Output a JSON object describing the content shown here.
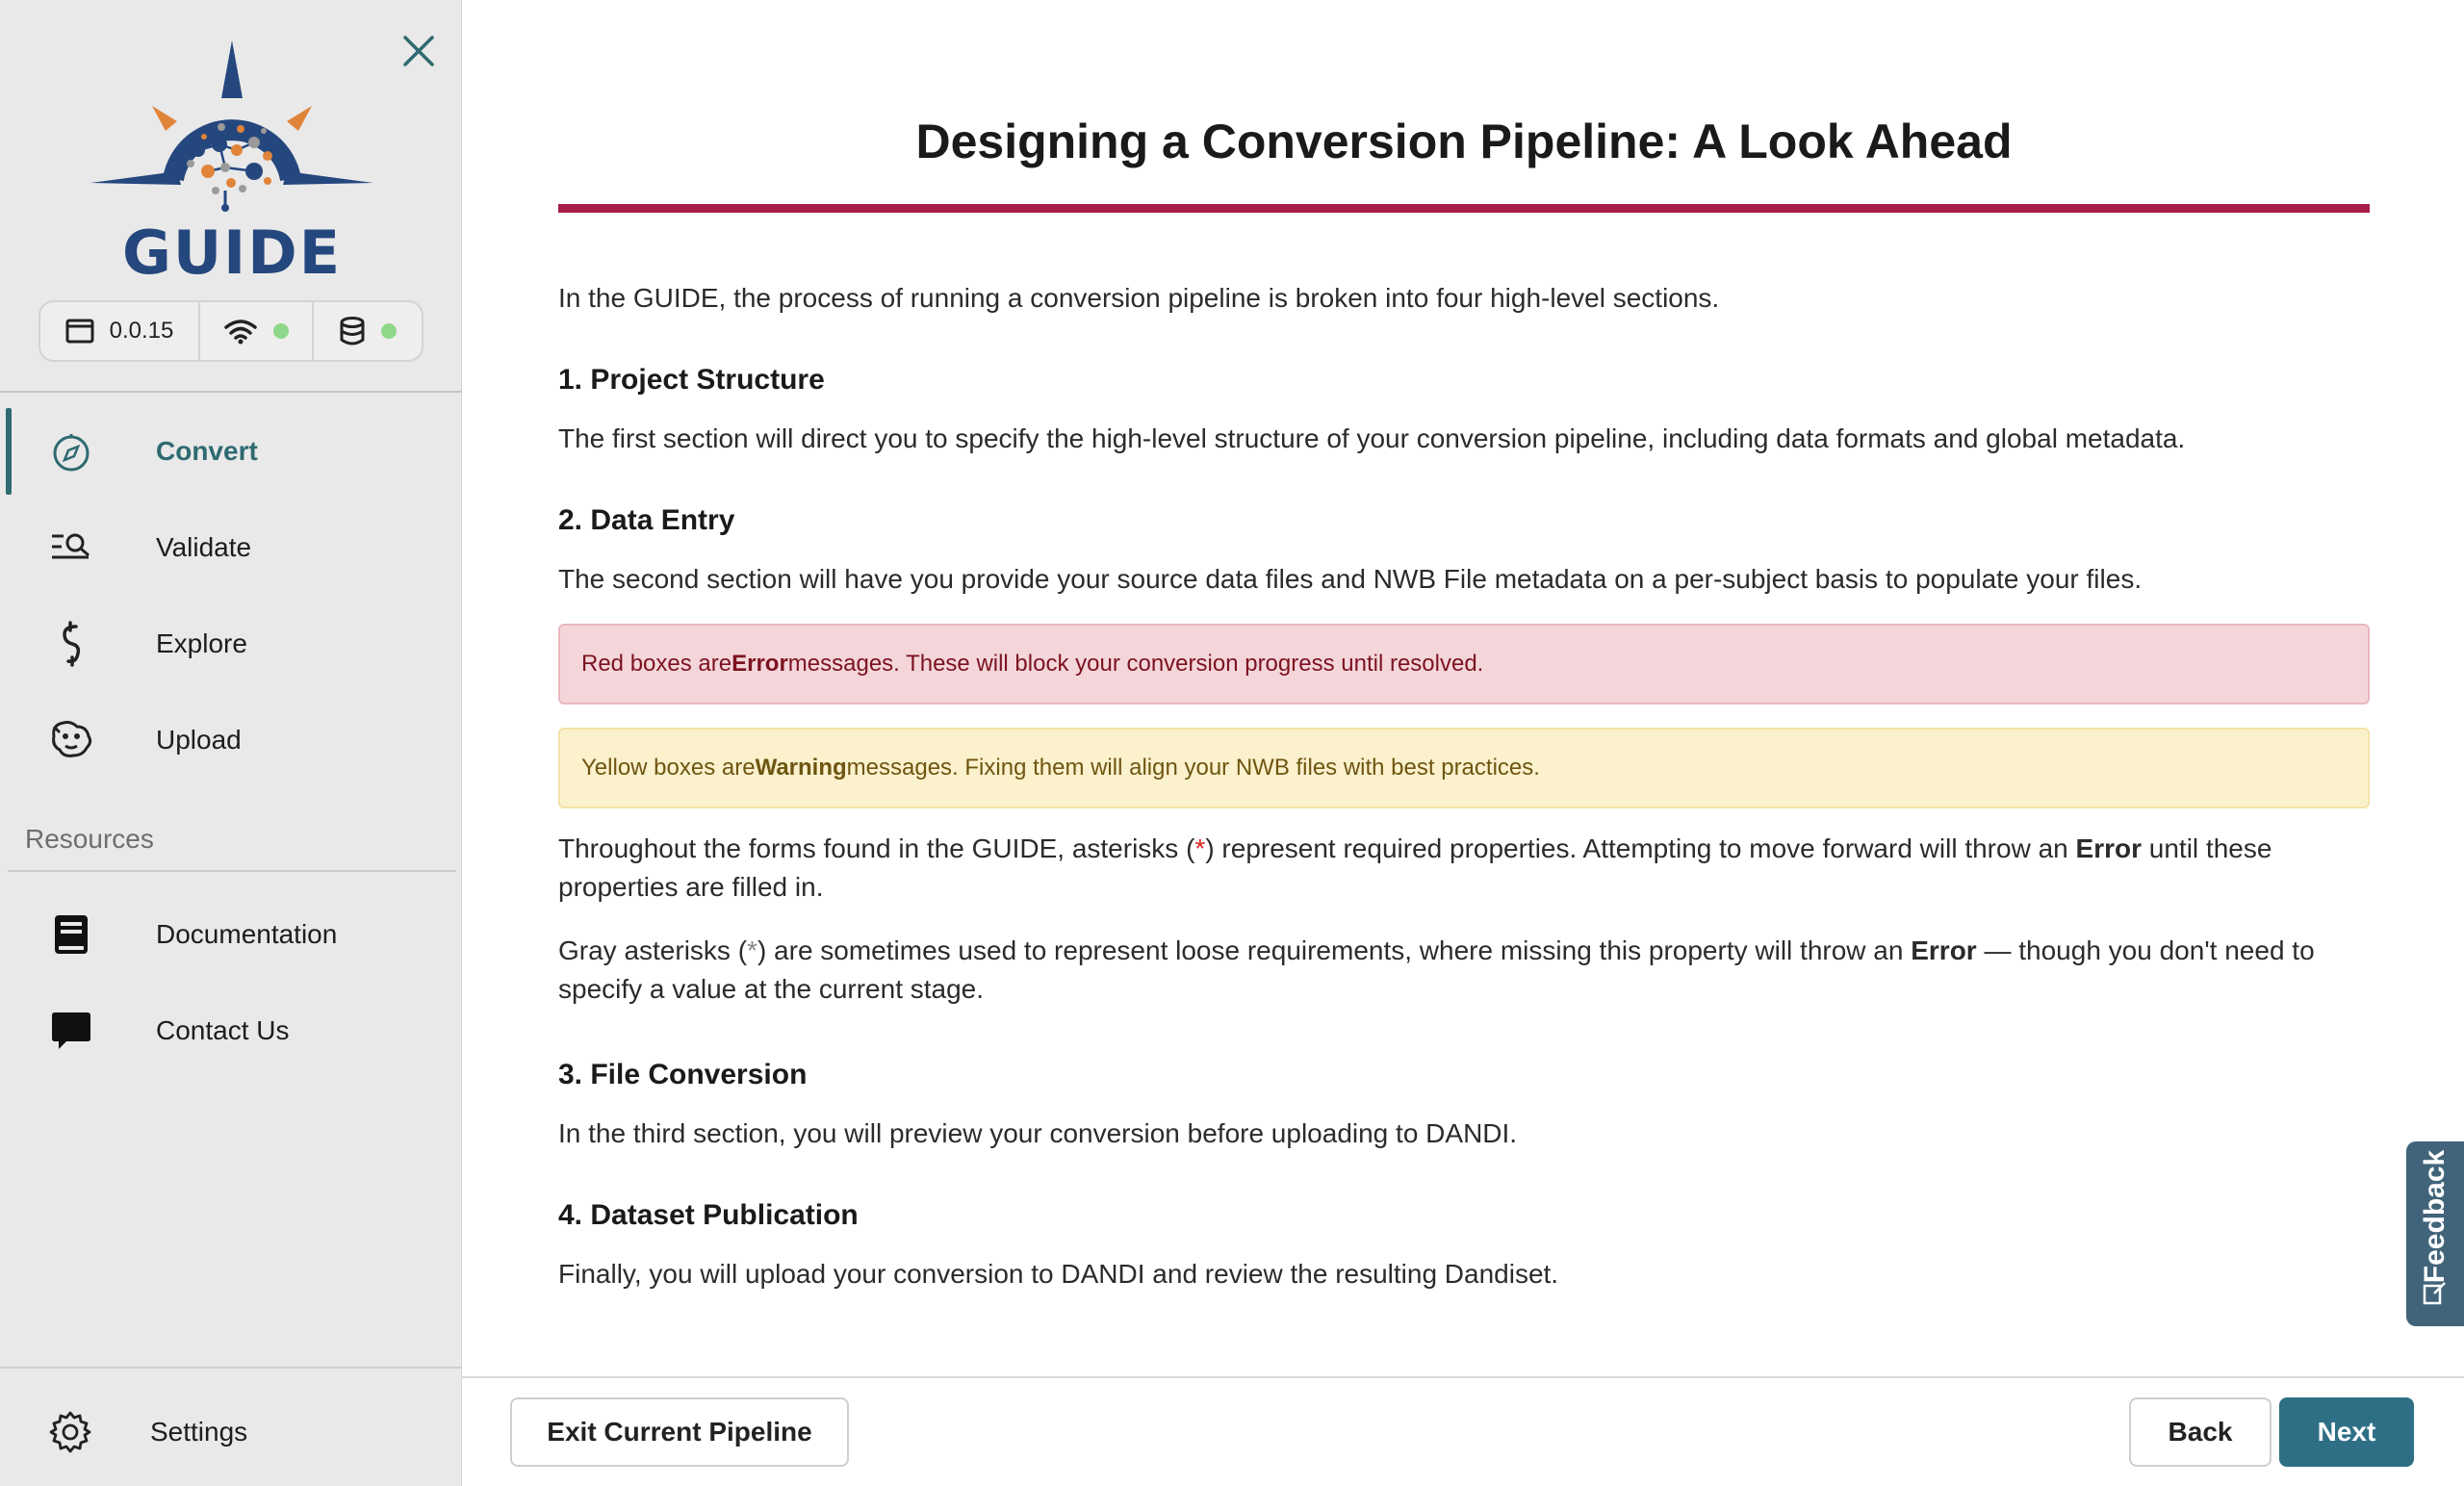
{
  "app": {
    "logo_text": "GUIDE",
    "version": "0.0.15",
    "status_colors": {
      "online": "#8fd88a"
    },
    "accent_color": "#2e6a71"
  },
  "sidebar": {
    "nav_items": [
      {
        "label": "Convert",
        "icon": "compass-icon",
        "active": true
      },
      {
        "label": "Validate",
        "icon": "list-search-icon",
        "active": false
      },
      {
        "label": "Explore",
        "icon": "hook-icon",
        "active": false
      },
      {
        "label": "Upload",
        "icon": "dandi-upload-icon",
        "active": false
      }
    ],
    "resources_label": "Resources",
    "resource_items": [
      {
        "label": "Documentation",
        "icon": "book-icon"
      },
      {
        "label": "Contact Us",
        "icon": "chat-bubble-icon"
      }
    ],
    "settings_label": "Settings"
  },
  "main": {
    "title": "Designing a Conversion Pipeline: A Look Ahead",
    "title_rule_color": "#a81d48",
    "intro": "In the GUIDE, the process of running a conversion pipeline is broken into four high-level sections.",
    "sections": [
      {
        "heading": "1. Project Structure",
        "body": "The first section will direct you to specify the high-level structure of your conversion pipeline, including data formats and global metadata."
      },
      {
        "heading": "2. Data Entry",
        "body": "The second section will have you provide your source data files and NWB File metadata on a per-subject basis to populate your files."
      },
      {
        "heading": "3. File Conversion",
        "body": "In the third section, you will preview your conversion before uploading to DANDI."
      },
      {
        "heading": "4. Dataset Publication",
        "body": "Finally, you will upload your conversion to DANDI and review the resulting Dandiset."
      }
    ],
    "error_alert": {
      "prefix": "Red boxes are ",
      "bold": "Error",
      "suffix": " messages. These will block your conversion progress until resolved."
    },
    "warning_alert": {
      "prefix": "Yellow boxes are ",
      "bold": "Warning",
      "suffix": " messages. Fixing them will align your NWB files with best practices."
    },
    "required_note": {
      "prefix": "Throughout the forms found in the GUIDE, asterisks (",
      "star": "*",
      "middle": ") represent required properties. Attempting to move forward will throw an ",
      "bold": "Error",
      "suffix": " until these properties are filled in."
    },
    "loose_note": {
      "prefix": "Gray asterisks (",
      "star": "*",
      "middle": ") are sometimes used to represent loose requirements, where missing this property will throw an ",
      "bold": "Error",
      "suffix": " — though you don't need to specify a value at the current stage."
    }
  },
  "footer": {
    "exit_label": "Exit Current Pipeline",
    "back_label": "Back",
    "next_label": "Next",
    "next_color": "#2e6f86"
  },
  "feedback": {
    "label": "Feedback"
  }
}
